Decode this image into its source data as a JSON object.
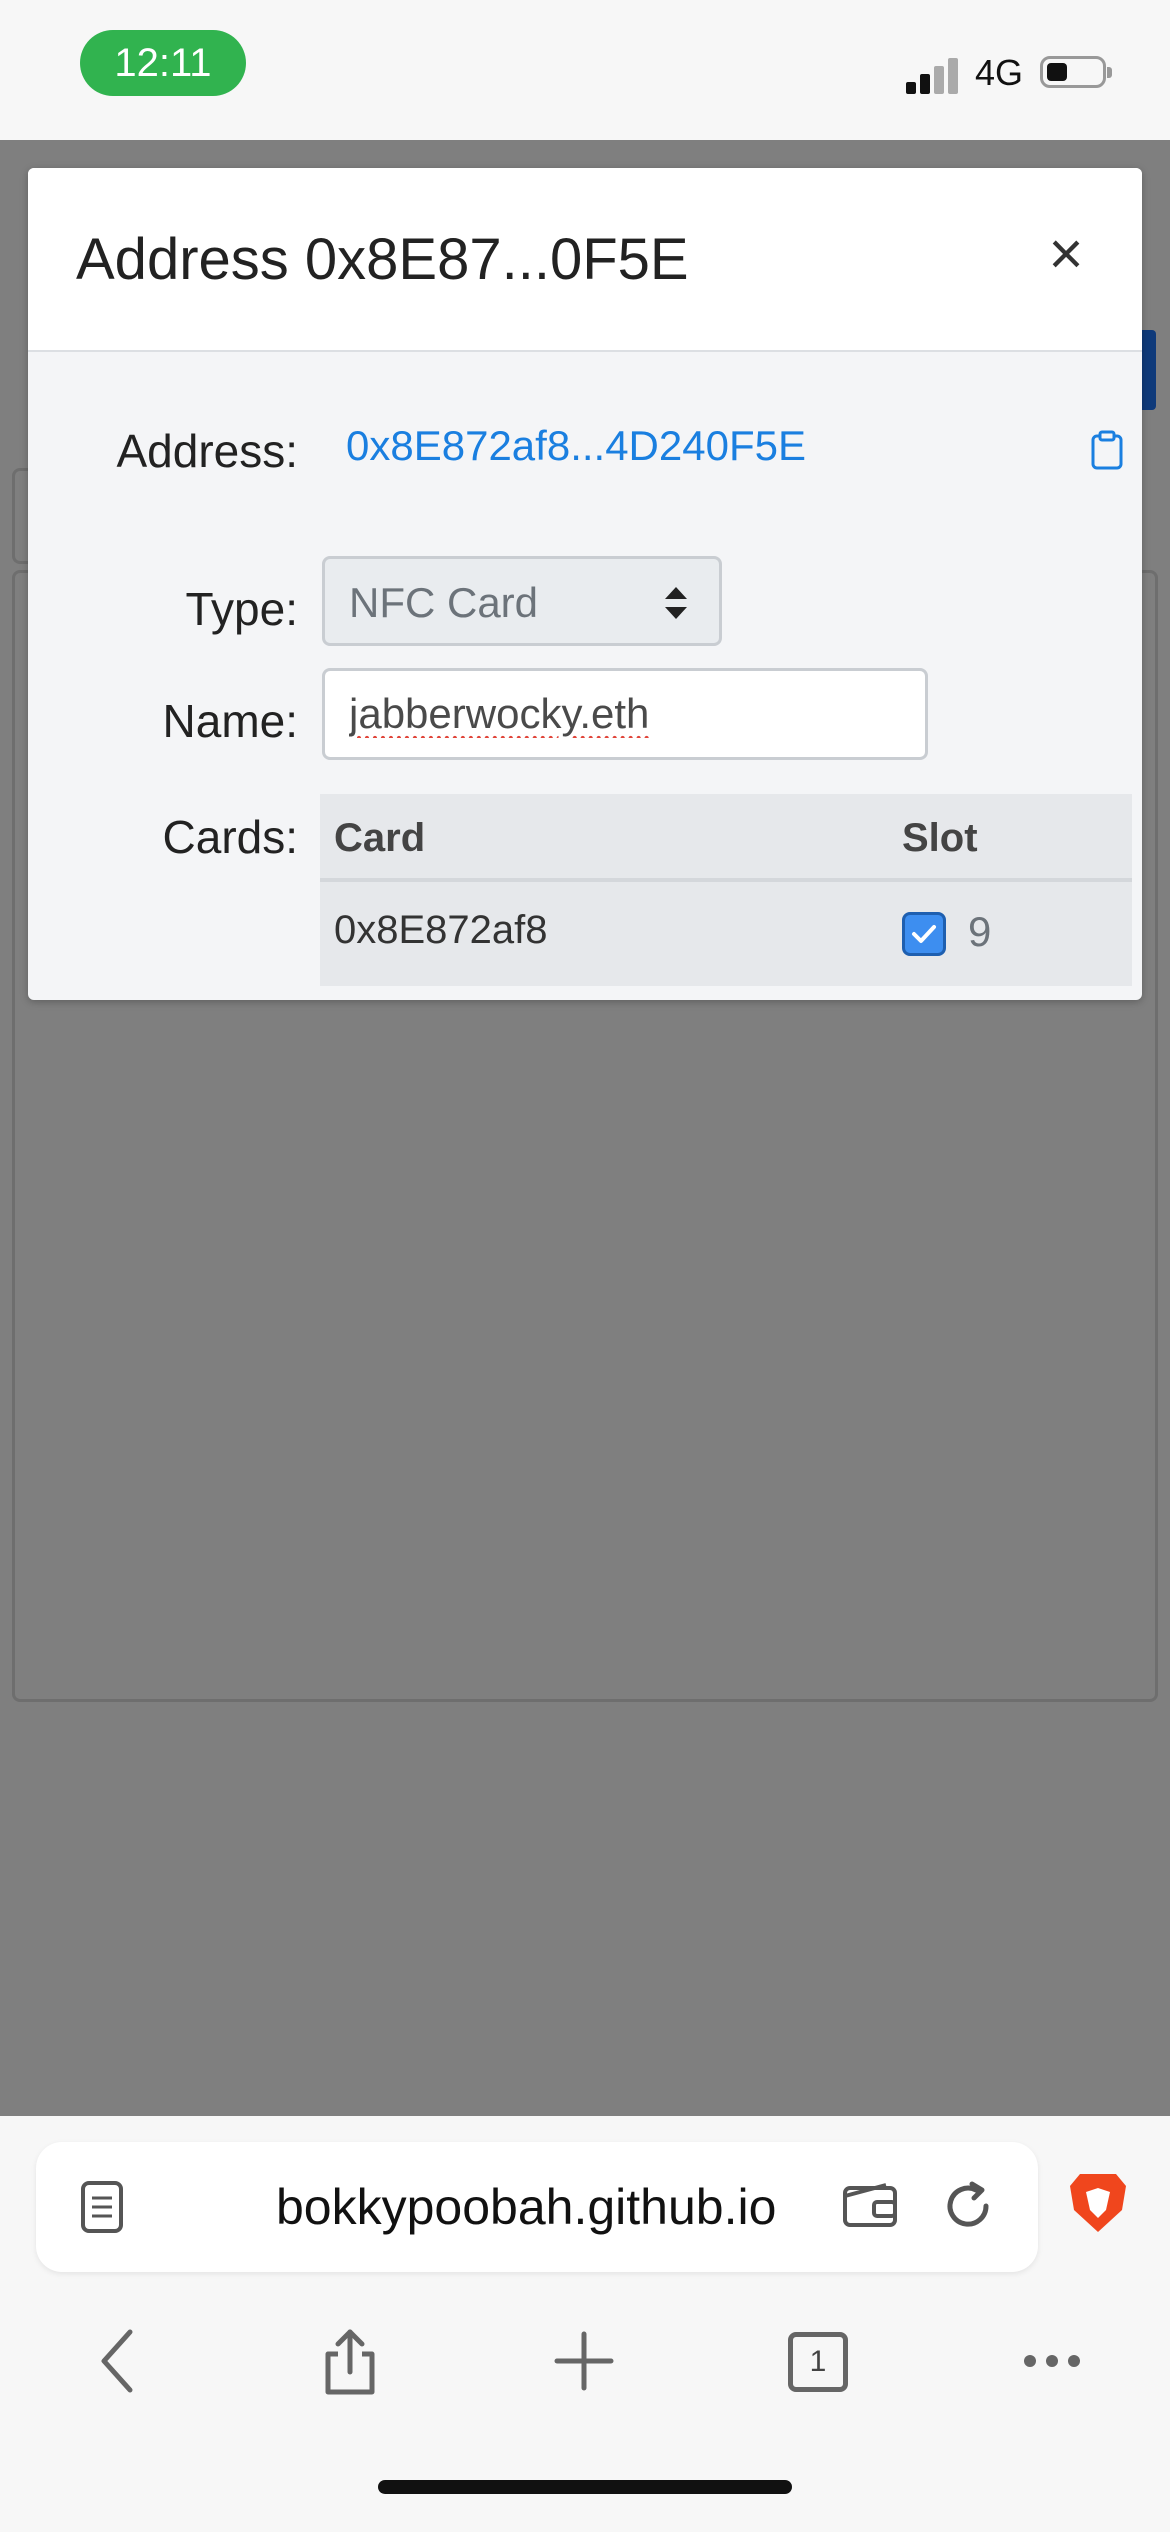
{
  "status_bar": {
    "time": "12:11",
    "network": "4G"
  },
  "modal": {
    "title": "Address 0x8E87...0F5E",
    "close_glyph": "×",
    "address_label": "Address:",
    "address_value": "0x8E872af8...4D240F5E",
    "type_label": "Type:",
    "type_selected": "NFC Card",
    "name_label": "Name:",
    "name_value": "jabberwocky.eth",
    "cards_label": "Cards:",
    "table": {
      "columns": [
        "Card",
        "Slot"
      ],
      "rows": [
        {
          "card": "0x8E872af8",
          "slot": "9",
          "checked": true
        }
      ]
    }
  },
  "browser": {
    "url": "bokkypoobah.github.io",
    "tab_count": "1",
    "icons": [
      "reader-icon",
      "wallet-icon",
      "reload-icon",
      "brave-lion-icon",
      "back-icon",
      "share-icon",
      "new-tab-icon",
      "tabs-icon",
      "more-icon"
    ]
  },
  "colors": {
    "accent": "#1a7fe0",
    "time_pill": "#31b34f",
    "overlay": "#7f7f7f",
    "brave": "#f0461d"
  }
}
